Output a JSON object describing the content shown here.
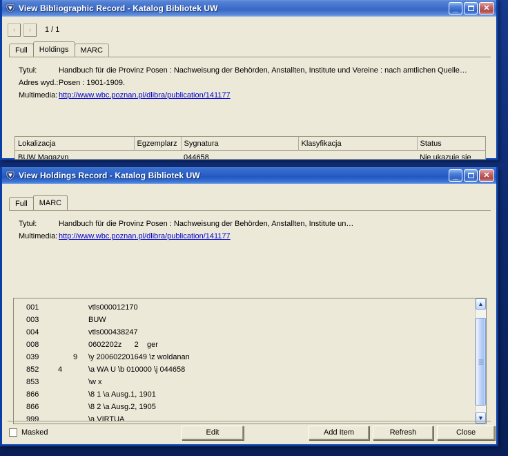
{
  "desktop": {
    "background": "#0e2a70"
  },
  "bib_window": {
    "title": "View Bibliographic Record - Katalog Bibliotek UW",
    "icon": "virtua-shield-icon",
    "controls": {
      "minimize": "_",
      "maximize": "□",
      "close": "✕"
    },
    "nav": {
      "prev": "‹",
      "next": "›",
      "page_count": "1 / 1"
    },
    "tabs": [
      {
        "label": "Full",
        "active": false
      },
      {
        "label": "Holdings",
        "active": true
      },
      {
        "label": "MARC",
        "active": false
      }
    ],
    "fields": [
      {
        "label": "Tytuł:",
        "value": "Handbuch für die Provinz Posen : Nachweisung der Behörden, Anstallten, Institute und Vereine : nach amtlichen Quelle…",
        "link": false
      },
      {
        "label": "Adres wyd.:",
        "value": "Posen : 1901-1909.",
        "link": false
      },
      {
        "label": "Multimedia:",
        "value": "http://www.wbc.poznan.pl/dlibra/publication/141177",
        "link": true
      }
    ],
    "holdings_grid": {
      "columns": [
        "Lokalizacja",
        "Egzemplarz",
        "Sygnatura",
        "Klasyfikacja",
        "Status"
      ],
      "rows": [
        [
          "BUW Magazyn",
          "",
          "044658",
          "",
          "Nie ukazuje się"
        ]
      ]
    }
  },
  "holdings_window": {
    "title": "View Holdings Record - Katalog Bibliotek UW",
    "icon": "virtua-shield-icon",
    "controls": {
      "minimize": "_",
      "maximize": "□",
      "close": "✕"
    },
    "tabs": [
      {
        "label": "Full",
        "active": false
      },
      {
        "label": "MARC",
        "active": true
      }
    ],
    "fields": [
      {
        "label": "Tytuł:",
        "value": "Handbuch für die Provinz Posen : Nachweisung der Behörden, Anstallten, Institute un…",
        "link": false
      },
      {
        "label": "Multimedia:",
        "value": "http://www.wbc.poznan.pl/dlibra/publication/141177",
        "link": true
      }
    ],
    "marc": {
      "rows": [
        {
          "tag": "001",
          "i1": "",
          "i2": "",
          "data": "vtls000012170"
        },
        {
          "tag": "003",
          "i1": "",
          "i2": "",
          "data": "BUW"
        },
        {
          "tag": "004",
          "i1": "",
          "i2": "",
          "data": "vtls000438247"
        },
        {
          "tag": "008",
          "i1": "",
          "i2": "",
          "data": "0602202z      2    ger"
        },
        {
          "tag": "039",
          "i1": "",
          "i2": "9",
          "data": "\\y 200602201649 \\z woldanan"
        },
        {
          "tag": "852",
          "i1": "4",
          "i2": "",
          "data": "\\a WA U \\b 010000 \\j 044658"
        },
        {
          "tag": "853",
          "i1": "",
          "i2": "",
          "data": "\\w x"
        },
        {
          "tag": "866",
          "i1": "",
          "i2": "",
          "data": "\\8 1 \\a Ausg.1, 1901"
        },
        {
          "tag": "866",
          "i1": "",
          "i2": "",
          "data": "\\8 2 \\a Ausg.2, 1905"
        },
        {
          "tag": "999",
          "i1": "",
          "i2": "",
          "data": "\\a VIRTUA"
        }
      ],
      "scrollbar": {
        "up": "▲",
        "down": "▼"
      }
    },
    "footer": {
      "masked_label": "Masked",
      "masked_checked": false,
      "buttons": [
        "Edit",
        "Add Item",
        "Refresh",
        "Close"
      ]
    }
  }
}
